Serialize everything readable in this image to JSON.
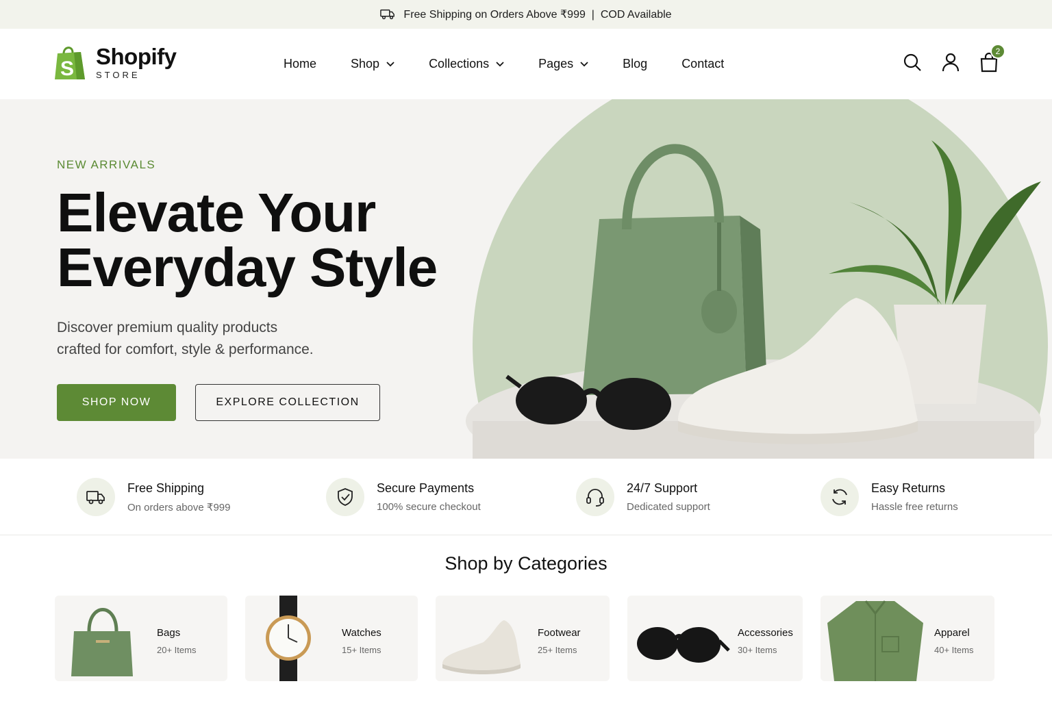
{
  "announcement": {
    "text": "Free Shipping on Orders Above ₹999  |  COD Available",
    "icon": "truck-icon"
  },
  "header": {
    "brand": {
      "name": "Shopify",
      "tagline": "STORE"
    },
    "nav": [
      {
        "label": "Home",
        "dropdown": false
      },
      {
        "label": "Shop",
        "dropdown": true
      },
      {
        "label": "Collections",
        "dropdown": true
      },
      {
        "label": "Pages",
        "dropdown": true
      },
      {
        "label": "Blog",
        "dropdown": false
      },
      {
        "label": "Contact",
        "dropdown": false
      }
    ],
    "icons": [
      "search-icon",
      "user-icon",
      "cart-icon"
    ],
    "cart_count": "2"
  },
  "hero": {
    "eyebrow": "NEW ARRIVALS",
    "title_line1": "Elevate Your",
    "title_line2": "Everyday Style",
    "subtitle_line1": "Discover premium quality products",
    "subtitle_line2": "crafted for comfort, style & performance.",
    "primary_cta": "SHOP NOW",
    "secondary_cta": "EXPLORE COLLECTION"
  },
  "features": [
    {
      "title": "Free Shipping",
      "subtitle": "On orders above ₹999",
      "icon": "truck-icon"
    },
    {
      "title": "Secure Payments",
      "subtitle": "100% secure checkout",
      "icon": "shield-check-icon"
    },
    {
      "title": "24/7 Support",
      "subtitle": "Dedicated support",
      "icon": "headset-icon"
    },
    {
      "title": "Easy Returns",
      "subtitle": "Hassle free returns",
      "icon": "refresh-icon"
    }
  ],
  "categories": {
    "title": "Shop by Categories",
    "items": [
      {
        "name": "Bags",
        "count": "20+ Items"
      },
      {
        "name": "Watches",
        "count": "15+ Items"
      },
      {
        "name": "Footwear",
        "count": "25+ Items"
      },
      {
        "name": "Accessories",
        "count": "30+ Items"
      },
      {
        "name": "Apparel",
        "count": "40+ Items"
      }
    ]
  },
  "colors": {
    "accent": "#5d8a35",
    "topbar_bg": "#f2f3ec",
    "hero_bg": "#f4f3f1",
    "hero_circle": "#c9d6be"
  }
}
